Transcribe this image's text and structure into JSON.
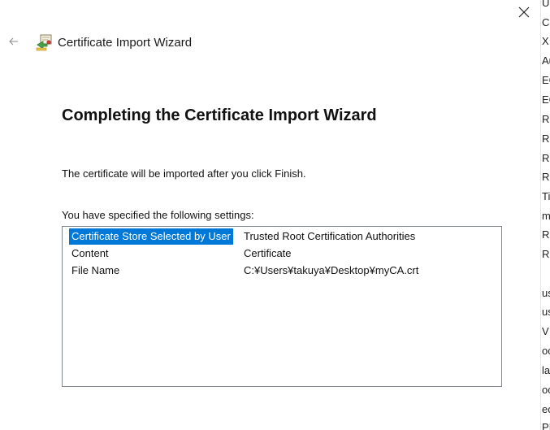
{
  "wizard": {
    "title": "Certificate Import Wizard",
    "heading": "Completing the Certificate Import Wizard",
    "info_text": "The certificate will be imported after you click Finish.",
    "settings_label": "You have specified the following settings:",
    "settings": [
      {
        "key": "Certificate Store Selected by User",
        "value": "Trusted Root Certification Authorities"
      },
      {
        "key": "Content",
        "value": "Certificate"
      },
      {
        "key": "File Name",
        "value": "C:¥Users¥takuya¥Desktop¥myCA.crt"
      }
    ]
  },
  "icons": {
    "back": "back-arrow-icon",
    "close": "close-icon",
    "wizard": "certificate-wizard-icon"
  },
  "background_window": {
    "lines": [
      "U",
      "Co",
      "X",
      "Au",
      "EC",
      "EC",
      "Ro",
      "Ro",
      "Ro",
      "Ro",
      "Ti",
      "m",
      "Ro",
      "Ro",
      "",
      "us",
      "us",
      "V F",
      "oc",
      "la",
      "oc",
      "ec",
      "PI"
    ]
  }
}
